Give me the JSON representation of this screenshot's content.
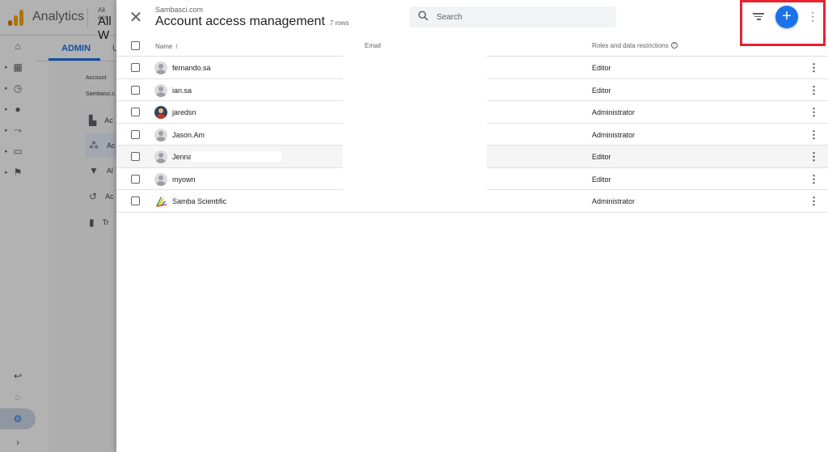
{
  "app": {
    "name": "Analytics",
    "account_small": "All acc",
    "account_big": "All W",
    "brand_colors": {
      "orange": "#f9ab00",
      "dark_orange": "#e37400",
      "accent": "#1a73e8",
      "highlight": "#e8222e"
    }
  },
  "background": {
    "admin_tab": "ADMIN",
    "tab_hint": "U",
    "account_label": "Account",
    "account_name": "Sambasci.c",
    "rows": [
      {
        "icon": "account-settings-icon",
        "label": "Ac"
      },
      {
        "icon": "people-icon",
        "label": "Ac"
      },
      {
        "icon": "filter-icon",
        "label": "Al"
      },
      {
        "icon": "history-icon",
        "label": "Ac"
      },
      {
        "icon": "trash-icon",
        "label": "Tr"
      }
    ]
  },
  "leftnav": {
    "items": [
      {
        "icon": "home-icon",
        "glyph": "⌂"
      },
      {
        "icon": "reports-icon",
        "glyph": "▦"
      },
      {
        "icon": "clock-icon",
        "glyph": "◷"
      },
      {
        "icon": "person-icon",
        "glyph": "●"
      },
      {
        "icon": "flow-icon",
        "glyph": "⤳"
      },
      {
        "icon": "display-icon",
        "glyph": "▭"
      },
      {
        "icon": "flag-icon",
        "glyph": "⚑"
      }
    ],
    "bottom": [
      {
        "icon": "route-icon",
        "glyph": "↩"
      },
      {
        "icon": "lightbulb-icon",
        "glyph": "◌"
      },
      {
        "icon": "admin-gear-icon",
        "glyph": "⚙"
      },
      {
        "icon": "expand-icon",
        "glyph": "›"
      }
    ]
  },
  "panel": {
    "subtitle": "Sambasci.com",
    "title": "Account access management",
    "row_count": "7 rows",
    "search_placeholder": "Search",
    "close_glyph": "✕",
    "add_glyph": "+",
    "more_glyph": "⋮"
  },
  "table": {
    "headers": {
      "name": "Name",
      "sort": "↑",
      "email": "Email",
      "role": "Roles and data restrictions",
      "help": "?"
    },
    "rows": [
      {
        "name": "fernando.sa",
        "role": "Editor",
        "avatar": "default"
      },
      {
        "name": "ian.sa",
        "role": "Editor",
        "avatar": "default"
      },
      {
        "name": "jaredsn",
        "role": "Administrator",
        "avatar": "photo"
      },
      {
        "name": "Jason.Am",
        "role": "Administrator",
        "avatar": "default"
      },
      {
        "name": "Jenna.E",
        "role": "Editor",
        "avatar": "default"
      },
      {
        "name": "myown",
        "role": "Editor",
        "avatar": "default"
      },
      {
        "name": "Samba Scientific",
        "role": "Administrator",
        "avatar": "brand"
      }
    ]
  }
}
